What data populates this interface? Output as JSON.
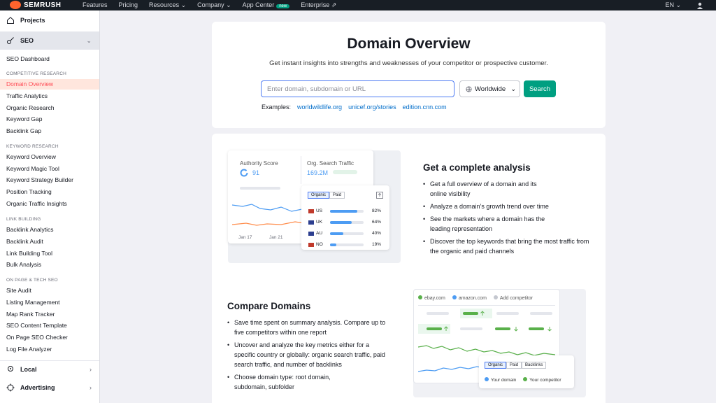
{
  "topbar": {
    "logo_text": "SEMRUSH",
    "nav": [
      "Features",
      "Pricing",
      "Resources ⌄",
      "Company ⌄",
      "App Center",
      "Enterprise ⇗"
    ],
    "app_center_badge": "new",
    "lang": "EN ⌄",
    "user_icon": "user-icon"
  },
  "sidebar": {
    "projects_label": "Projects",
    "seo_label": "SEO",
    "dashboard_label": "SEO Dashboard",
    "sections": {
      "competitive": "COMPETITIVE RESEARCH",
      "keyword": "KEYWORD RESEARCH",
      "link": "LINK BUILDING",
      "onpage": "ON PAGE & TECH SEO"
    },
    "competitive_items": [
      "Domain Overview",
      "Traffic Analytics",
      "Organic Research",
      "Keyword Gap",
      "Backlink Gap"
    ],
    "keyword_items": [
      "Keyword Overview",
      "Keyword Magic Tool",
      "Keyword Strategy Builder",
      "Position Tracking",
      "Organic Traffic Insights"
    ],
    "link_items": [
      "Backlink Analytics",
      "Backlink Audit",
      "Link Building Tool",
      "Bulk Analysis"
    ],
    "onpage_items": [
      "Site Audit",
      "Listing Management",
      "Map Rank Tracker",
      "SEO Content Template",
      "On Page SEO Checker",
      "Log File Analyzer"
    ],
    "local_label": "Local",
    "advertising_label": "Advertising",
    "active_item": "Domain Overview"
  },
  "hero": {
    "title": "Domain Overview",
    "subtitle": "Get instant insights into strengths and weaknesses of your competitor or prospective customer.",
    "search_placeholder": "Enter domain, subdomain or URL",
    "database": "Worldwide",
    "search_button": "Search",
    "examples_label": "Examples:",
    "examples": [
      "worldwildlife.org",
      "unicef.org/stories",
      "edition.cnn.com"
    ]
  },
  "analysis": {
    "heading": "Get a complete analysis",
    "bullets": [
      "Get a full overview of a domain and its online visibility",
      "Analyze a domain’s growth trend over time",
      "See the markets where a domain has the leading representation",
      "Discover the top keywords that bring the most traffic from the organic and paid channels"
    ],
    "mock": {
      "authority_label": "Authority Score",
      "authority_value": "91",
      "traffic_label": "Org. Search Traffic",
      "traffic_value": "169.2M",
      "dates": [
        "Jan 17",
        "Jan 21"
      ],
      "tabs": [
        "Organic",
        "Paid"
      ],
      "countries": [
        {
          "code": "US",
          "pct": "82%",
          "fill": 0.82
        },
        {
          "code": "UK",
          "pct": "64%",
          "fill": 0.64
        },
        {
          "code": "AU",
          "pct": "40%",
          "fill": 0.4
        },
        {
          "code": "NO",
          "pct": "19%",
          "fill": 0.19
        }
      ]
    }
  },
  "compare": {
    "heading": "Compare Domains",
    "bullets": [
      "Save time spent on summary analysis. Compare up to five competitors within one report",
      "Uncover and analyze the key metrics either for a specific country or globally: organic search traffic, paid search traffic, and number of backlinks",
      "Choose domain type: root domain, subdomain, subfolder"
    ],
    "mock": {
      "domains": [
        "ebay.com",
        "amazon.com",
        "Add competitor"
      ],
      "tabs": [
        "Organic",
        "Paid",
        "Backlinks"
      ],
      "legend": [
        "Your domain",
        "Your competitor"
      ]
    }
  },
  "colors": {
    "accent": "#ff642d",
    "active_text": "#ff4953",
    "search_green": "#009f81",
    "link_blue": "#006dca",
    "your_domain": "#4d9cf3",
    "competitor": "#59b04a"
  }
}
